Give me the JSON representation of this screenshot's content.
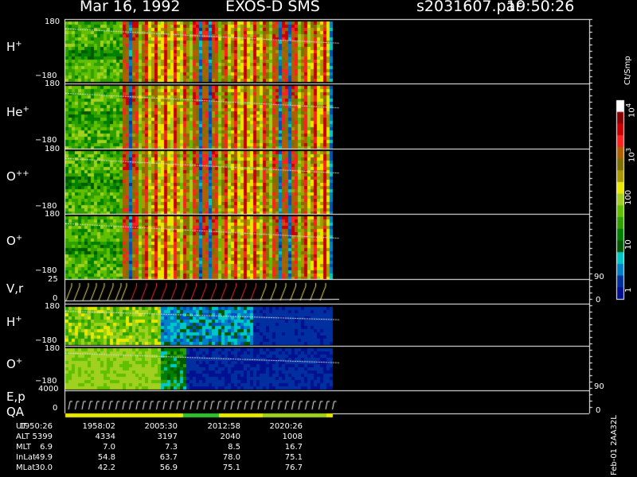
{
  "header": {
    "date": "Mar 16, 1992",
    "instrument": "EXOS-D SMS",
    "file": "s2031607.par",
    "time": "19:50:26"
  },
  "panels": [
    {
      "label": "H",
      "charge": "+",
      "ymax": "180",
      "ymin": "−180"
    },
    {
      "label": "He",
      "charge": "+",
      "ymax": "180",
      "ymin": "−180"
    },
    {
      "label": "O",
      "charge": "++",
      "ymax": "180",
      "ymin": "−180"
    },
    {
      "label": "O",
      "charge": "+",
      "ymax": "180",
      "ymin": "−180"
    }
  ],
  "vr_panel": {
    "label": "V,r",
    "ymax": "25",
    "ymin": "0",
    "right_max": "90",
    "right_min": "0"
  },
  "h2_panel": {
    "label": "H",
    "charge": "+",
    "ymax": "180",
    "ymin": "−180"
  },
  "o2_panel": {
    "label": "O",
    "charge": "+",
    "ymax": "180",
    "ymin": "−180"
  },
  "ep_panel": {
    "label1": "E,p",
    "label2": "QA",
    "ymax": "4000",
    "ymin": "0",
    "right_max": "90",
    "right_min": "0"
  },
  "colorbar": {
    "unit": "Ct/Smp",
    "ticks": [
      {
        "text": "10",
        "sup": "4"
      },
      {
        "text": "10",
        "sup": "3"
      },
      {
        "text": "100",
        "sup": ""
      },
      {
        "text": "10",
        "sup": ""
      },
      {
        "text": "1",
        "sup": ""
      }
    ],
    "colors": [
      "#ffffff",
      "#8b0000",
      "#c80000",
      "#ff2020",
      "#b06000",
      "#807000",
      "#a89a00",
      "#e8e800",
      "#a0d020",
      "#60c000",
      "#30a000",
      "#008000",
      "#005800",
      "#00c8c8",
      "#0080c8",
      "#0030a0",
      "#001090"
    ]
  },
  "footer_code": "Feb-01 2AA32L",
  "ephemeris": {
    "labels": [
      "UT",
      "ALT",
      "MLT",
      "InLat",
      "MLat"
    ],
    "columns": [
      [
        "1950:26",
        "5399",
        "6.9",
        "49.9",
        "30.0"
      ],
      [
        "1958:02",
        "4334",
        "7.0",
        "54.8",
        "42.2"
      ],
      [
        "2005:30",
        "3197",
        "7.3",
        "63.7",
        "56.9"
      ],
      [
        "2012:58",
        "2040",
        "8.5",
        "78.0",
        "75.1"
      ],
      [
        "2020:26",
        "1008",
        "16.7",
        "75.1",
        "76.7"
      ]
    ]
  },
  "chart_data": {
    "type": "heatmap",
    "title": "",
    "x_time_ticks": [
      "1950:26",
      "1958:02",
      "2005:30",
      "2012:58",
      "2020:26"
    ],
    "y_range_pitch": [
      -180,
      180
    ],
    "vr_range": [
      0,
      25
    ],
    "energy_range": [
      0,
      4000
    ],
    "colorbar_range_counts": [
      1,
      10000
    ],
    "colorbar_scale": "log"
  }
}
